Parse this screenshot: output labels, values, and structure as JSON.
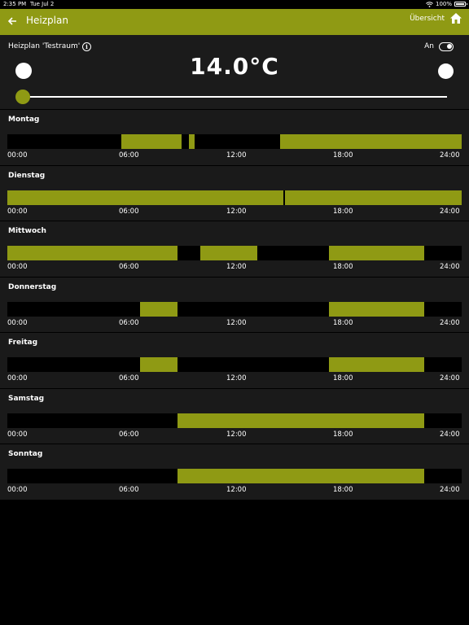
{
  "status": {
    "time": "2:35 PM",
    "date": "Tue Jul 2",
    "battery": "100%"
  },
  "nav": {
    "back_icon": "arrow-left-icon",
    "title": "Heizplan",
    "overview_label": "Übersicht",
    "home_icon": "home-icon"
  },
  "header": {
    "plan_label": "Heizplan 'Testraum'",
    "info_icon": "i",
    "toggle_label": "An",
    "toggle_on": true,
    "temperature": "14.0°C",
    "slider_level": 0
  },
  "accent_color": "#8f9a14",
  "tick_labels": [
    "00:00",
    "06:00",
    "12:00",
    "18:00",
    "24:00"
  ],
  "days": [
    {
      "name": "Montag",
      "segments": [
        [
          6.0,
          9.2
        ],
        [
          9.6,
          9.9
        ],
        [
          14.4,
          24.0
        ]
      ]
    },
    {
      "name": "Dienstag",
      "segments": [
        [
          0.0,
          14.6
        ],
        [
          14.65,
          24.0
        ]
      ]
    },
    {
      "name": "Mittwoch",
      "segments": [
        [
          0.0,
          9.0
        ],
        [
          10.2,
          13.2
        ],
        [
          17.0,
          22.0
        ]
      ]
    },
    {
      "name": "Donnerstag",
      "segments": [
        [
          7.0,
          9.0
        ],
        [
          17.0,
          22.0
        ]
      ]
    },
    {
      "name": "Freitag",
      "segments": [
        [
          7.0,
          9.0
        ],
        [
          17.0,
          22.0
        ]
      ]
    },
    {
      "name": "Samstag",
      "segments": [
        [
          9.0,
          22.0
        ]
      ]
    },
    {
      "name": "Sonntag",
      "segments": [
        [
          9.0,
          22.0
        ]
      ]
    }
  ]
}
